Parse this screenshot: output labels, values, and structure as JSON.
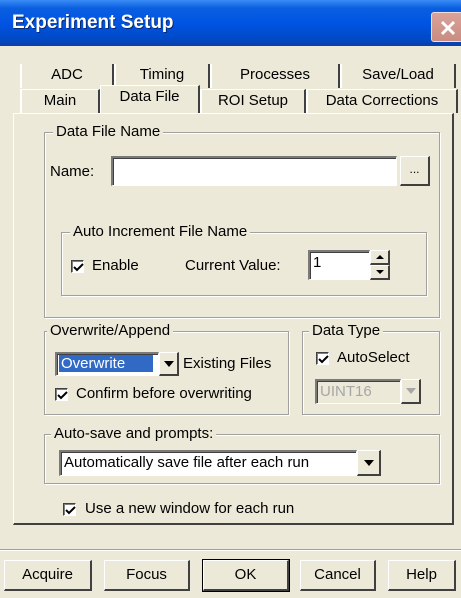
{
  "window": {
    "title": "Experiment Setup"
  },
  "tabs": {
    "back_row": [
      "ADC",
      "Timing",
      "Processes",
      "Save/Load"
    ],
    "front_row": [
      "Main",
      "Data File",
      "ROI Setup",
      "Data Corrections"
    ],
    "active": "Data File"
  },
  "data_file_name": {
    "group_label": "Data File Name",
    "name_label": "Name:",
    "name_value": "",
    "browse_label": "...",
    "auto_increment": {
      "group_label": "Auto Increment File Name",
      "enable_label": "Enable",
      "enable_checked": true,
      "current_value_label": "Current Value:",
      "current_value": "1"
    }
  },
  "overwrite_append": {
    "group_label": "Overwrite/Append",
    "mode_selected": "Overwrite",
    "existing_files_label": "Existing Files",
    "confirm_label": "Confirm before overwriting",
    "confirm_checked": true
  },
  "data_type": {
    "group_label": "Data Type",
    "autoselect_label": "AutoSelect",
    "autoselect_checked": true,
    "type_selected": "UINT16"
  },
  "autosave": {
    "group_label": "Auto-save and prompts:",
    "option_selected": "Automatically save file after each run"
  },
  "new_window": {
    "label": "Use a new window for each run",
    "checked": true
  },
  "buttons": {
    "acquire": "Acquire",
    "focus": "Focus",
    "ok": "OK",
    "cancel": "Cancel",
    "help": "Help"
  },
  "colors": {
    "title_bar": "#0054e3",
    "dialog_bg": "#ece9d8",
    "selection": "#316ac5"
  }
}
